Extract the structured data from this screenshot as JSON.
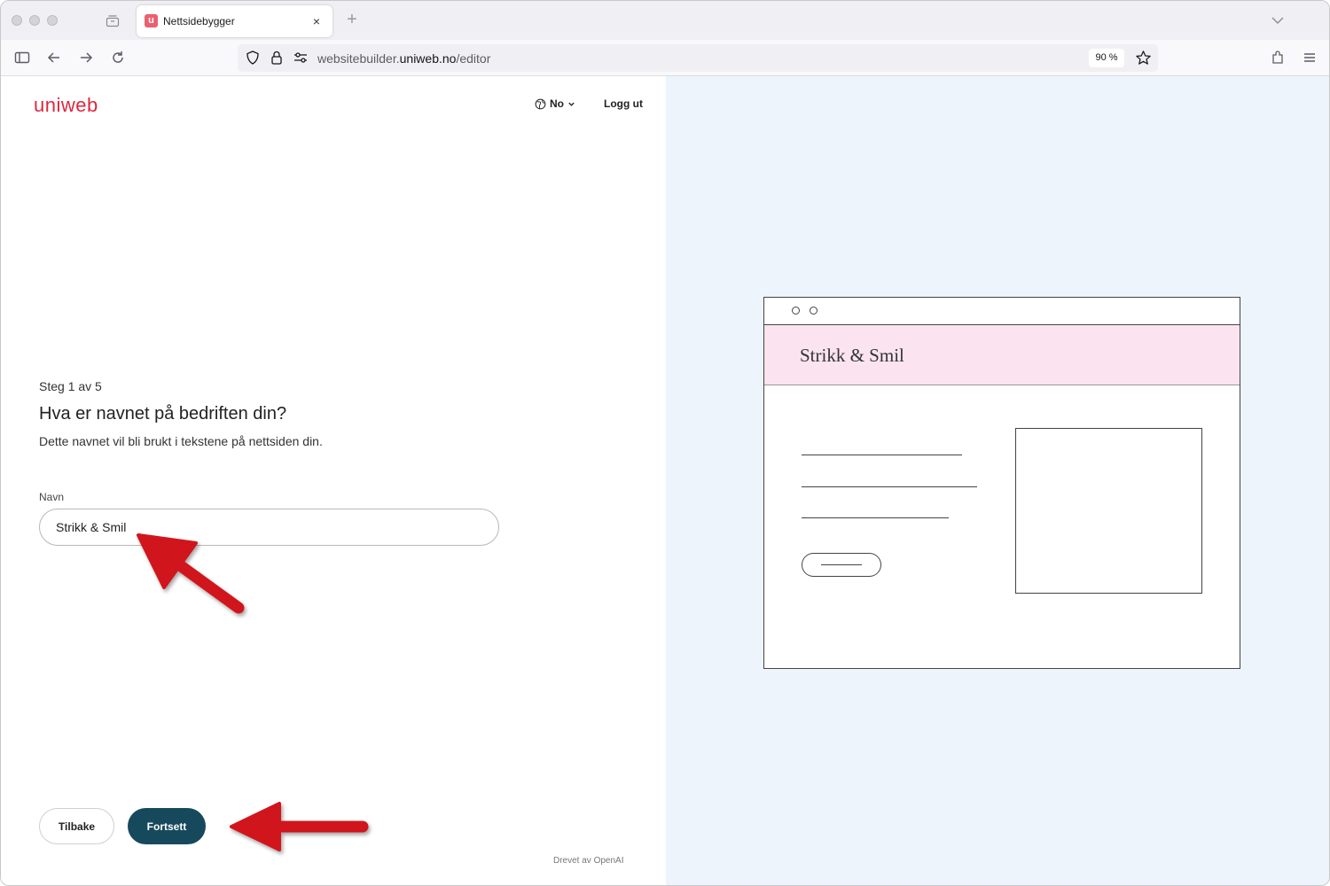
{
  "browser": {
    "tab_title": "Nettsidebygger",
    "tab_favicon_letter": "u",
    "close_glyph": "×",
    "new_tab_glyph": "+",
    "url_prefix": "websitebuilder.",
    "url_host": "uniweb.no",
    "url_path": "/editor",
    "zoom": "90 %",
    "icons": [
      "sidebar-icon",
      "back-icon",
      "forward-icon",
      "reload-icon",
      "shield-icon",
      "lock-icon",
      "permissions-icon",
      "bookmark-star-icon",
      "extensions-icon",
      "menu-icon"
    ]
  },
  "header": {
    "logo": "uniweb",
    "language": "No",
    "logout": "Logg ut"
  },
  "form": {
    "step": "Steg 1 av 5",
    "question": "Hva er navnet på bedriften din?",
    "description": "Dette navnet vil bli brukt i tekstene på nettsiden din.",
    "field_label": "Navn",
    "field_value": "Strikk & Smil",
    "back_label": "Tilbake",
    "continue_label": "Fortsett"
  },
  "footer": {
    "powered_by": "Drevet av OpenAI"
  },
  "preview": {
    "site_title": "Strikk & Smil"
  },
  "colors": {
    "brand_red": "#e0263d",
    "primary_button": "#17495d",
    "preview_background": "#edf4fc",
    "preview_header": "#fbe4ef",
    "annotation_arrow": "#d0121f"
  }
}
